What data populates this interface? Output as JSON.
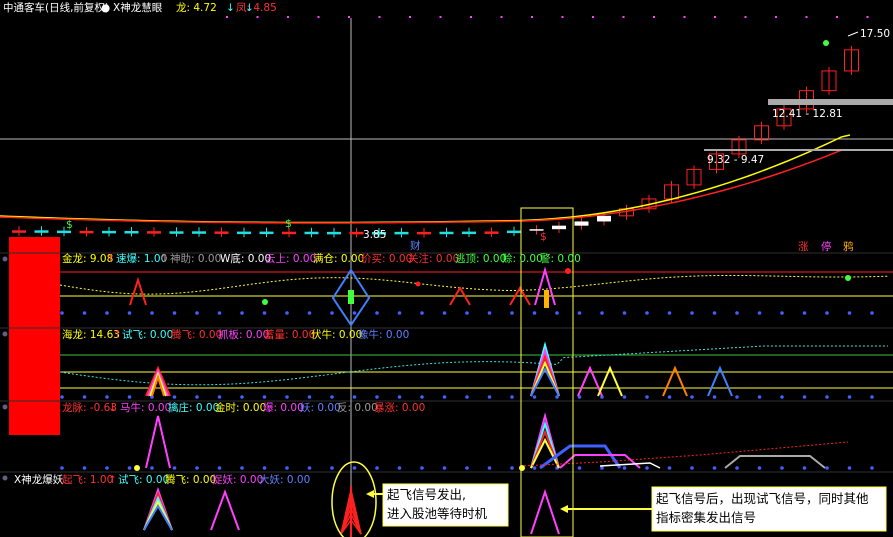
{
  "header": {
    "stock": "中通客车(日线,前复权)",
    "indicator": "X神龙慧眼",
    "items": [
      {
        "label": "龙: 4.72",
        "arrow": "↓",
        "color": "#ffff00"
      },
      {
        "label": "凤: 4.85",
        "arrow": "↓",
        "color": "#ff3030"
      }
    ]
  },
  "main": {
    "high_label": "17.50",
    "low_label": "3.85",
    "cai_label": "财",
    "range_high": "12.41 - 12.81",
    "range_low": "9.32 - 9.47",
    "badges": [
      {
        "text": "涨",
        "color": "#ff3030"
      },
      {
        "text": "停",
        "color": "#ff40ff"
      },
      {
        "text": "鸦",
        "color": "#ffb000"
      }
    ],
    "dollar_icons": [
      "$",
      "$",
      "$"
    ]
  },
  "panel1": {
    "items": [
      {
        "text": "金龙: 9.08",
        "arrow": "↑",
        "color": "#ffff00"
      },
      {
        "text": "速爆: 1.00",
        "arrow": "↑",
        "color": "#40ffff"
      },
      {
        "text": "神助: 0.00",
        "color": "#9a9a9a"
      },
      {
        "text": "W底: 0.00",
        "color": "#ffffff"
      },
      {
        "text": "云上: 0.00",
        "color": "#ff40ff"
      },
      {
        "text": "满仓: 0.00",
        "color": "#ffff00"
      },
      {
        "text": "价买: 0.00",
        "color": "#ff3030"
      },
      {
        "text": "关注: 0.00",
        "color": "#ff3030"
      },
      {
        "text": "逃顶: 0.00",
        "color": "#40ff40"
      },
      {
        "text": "赊: 0.00",
        "color": "#40ff40"
      },
      {
        "text": "警: 0.00",
        "color": "#40ff40"
      }
    ]
  },
  "panel2": {
    "items": [
      {
        "text": "海龙: 14.63",
        "arrow": "↑",
        "color": "#ffff00"
      },
      {
        "text": "试飞: 0.00",
        "color": "#40ffff"
      },
      {
        "text": "腾飞: 0.00",
        "color": "#ff3030"
      },
      {
        "text": "抓板: 0.00",
        "color": "#ff40ff"
      },
      {
        "text": "蓄量: 0.00",
        "color": "#ff3030"
      },
      {
        "text": "伏牛: 0.00",
        "color": "#ffff00"
      },
      {
        "text": "像牛: 0.00",
        "color": "#6080ff"
      }
    ]
  },
  "panel3": {
    "items": [
      {
        "text": "龙脉: -0.63",
        "arrow": "↓",
        "color": "#ff3030"
      },
      {
        "text": "马牛: 0.00",
        "color": "#ff40ff"
      },
      {
        "text": "擒庄: 0.00",
        "color": "#40ffff"
      },
      {
        "text": "金时: 0.00",
        "color": "#ffff00"
      },
      {
        "text": "爆: 0.00",
        "color": "#ff40ff"
      },
      {
        "text": "妖: 0.00",
        "color": "#6080ff"
      },
      {
        "text": "反: 0.00",
        "color": "#9a9a9a"
      },
      {
        "text": "暴涨: 0.00",
        "color": "#ff3030"
      }
    ]
  },
  "panel4": {
    "title": "X神龙爆妖",
    "items": [
      {
        "text": "起飞: 1.00",
        "arrow": "↑",
        "color": "#ff3030"
      },
      {
        "text": "试飞: 0.00",
        "color": "#40ffff"
      },
      {
        "text": "腾飞: 0.00",
        "color": "#ffff00"
      },
      {
        "text": "捉妖: 0.00",
        "color": "#ff40ff"
      },
      {
        "text": "大妖: 0.00",
        "color": "#6080ff"
      }
    ]
  },
  "annotations": {
    "note1_line1": "起飞信号发出,",
    "note1_line2": "进入股池等待时机",
    "note2_line1": "起飞信号后，出现试飞信号，同时其他",
    "note2_line2": "指标密集发出信号"
  },
  "chart_data": [
    {
      "type": "candlestick",
      "ohlc": [
        {
          "close_trend": [
            3.97,
            3.95,
            3.93,
            3.93,
            3.92,
            3.91,
            3.9,
            3.9,
            3.89,
            3.88,
            3.88,
            3.87,
            3.87,
            3.86,
            3.86,
            3.85,
            3.85,
            3.86,
            3.86,
            3.87,
            3.88,
            3.89,
            3.95,
            4.05,
            4.3,
            4.6,
            5.0,
            5.5,
            6.2,
            7.2,
            8.3,
            9.4,
            10.4,
            11.4,
            12.6,
            13.9,
            15.3,
            16.8
          ]
        }
      ],
      "annotations": {
        "max": 17.5,
        "min": 3.85
      },
      "price_bands": [
        [
          12.41,
          12.81
        ],
        [
          9.32,
          9.47
        ]
      ],
      "moving_averages": [
        "龙",
        "凤"
      ]
    },
    {
      "type": "line",
      "series": [
        {
          "name": "金龙",
          "value": 9.08
        }
      ]
    },
    {
      "type": "line",
      "series": [
        {
          "name": "海龙",
          "value": 14.63
        }
      ]
    },
    {
      "type": "line",
      "series": [
        {
          "name": "龙脉",
          "value": -0.63
        }
      ]
    }
  ]
}
